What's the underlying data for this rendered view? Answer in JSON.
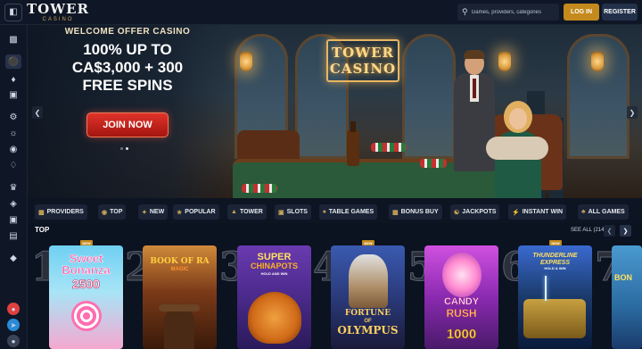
{
  "header": {
    "logo_main": "TOWER",
    "logo_sub": "CASINO",
    "search_placeholder": "Games, providers, categories",
    "login_label": "LOG IN",
    "register_label": "REGISTER"
  },
  "sidebar": {
    "icons": [
      "menu-icon",
      "gift-icon",
      "lobby-icon",
      "casino-icon",
      "live-icon",
      "sports-icon",
      "bonus-icon",
      "promotions-icon",
      "tournament-icon",
      "vip-icon",
      "shop-icon",
      "leaderboard-icon",
      "support-icon",
      "telegram-icon",
      "chat-icon"
    ]
  },
  "hero": {
    "subtitle": "WELCOME OFFER CASINO",
    "title_line1": "100% UP TO",
    "title_line2": "CA$3,000 + 300",
    "title_line3": "FREE SPINS",
    "cta_label": "JOIN NOW",
    "sign_line1": "TOWER",
    "sign_line2": "CASINO",
    "slide_count": 2,
    "active_slide": 1
  },
  "categories": [
    {
      "label": "PROVIDERS",
      "icon": "providers-icon"
    },
    {
      "label": "TOP",
      "icon": "top-icon"
    },
    {
      "label": "NEW",
      "icon": "new-icon"
    },
    {
      "label": "POPULAR",
      "icon": "popular-icon"
    },
    {
      "label": "TOWER",
      "icon": "tower-icon"
    },
    {
      "label": "SLOTS",
      "icon": "slots-icon"
    },
    {
      "label": "TABLE GAMES",
      "icon": "table-games-icon"
    },
    {
      "label": "BONUS BUY",
      "icon": "bonus-buy-icon"
    },
    {
      "label": "JACKPOTS",
      "icon": "jackpots-icon"
    },
    {
      "label": "INSTANT WIN",
      "icon": "instant-win-icon"
    },
    {
      "label": "ALL GAMES",
      "icon": "all-games-icon"
    }
  ],
  "top_section": {
    "title": "TOP",
    "see_all": "SEE ALL (214)",
    "games": [
      {
        "rank": "1",
        "title": "Sweet Bonanza 2500",
        "title_line1": "Sweet",
        "title_line2": "Bonanza",
        "title_line3": "2500",
        "badge": "NEW",
        "bg": "#5ec3ea"
      },
      {
        "rank": "2",
        "title": "Book of Ra Magic",
        "title_line1": "BOOK OF RA",
        "title_line2": "MAGIC",
        "title_line3": "",
        "badge": "",
        "bg": "#5a2a14"
      },
      {
        "rank": "3",
        "title": "Super ChinaPots",
        "title_line1": "SUPER",
        "title_line2": "CHINAPOTS",
        "title_line3": "HOLD AND WIN",
        "badge": "",
        "bg": "#4a2a8a"
      },
      {
        "rank": "4",
        "title": "Fortune of Olympus",
        "title_line1": "FORTUNE",
        "title_line2": "OF",
        "title_line3": "OLYMPUS",
        "badge": "NEW",
        "bg": "#2a3a7a"
      },
      {
        "rank": "5",
        "title": "Candy Rush 1000",
        "title_line1": "CANDY",
        "title_line2": "RUSH",
        "title_line3": "1000",
        "badge": "",
        "bg": "#7a2aa0"
      },
      {
        "rank": "6",
        "title": "Thunderline Express",
        "title_line1": "THUNDERLINE",
        "title_line2": "EXPRESS",
        "title_line3": "HOLD & WIN",
        "badge": "NEW",
        "bg": "#1a3a6a"
      },
      {
        "rank": "7",
        "title": "Bonanza",
        "title_line1": "BON",
        "title_line2": "",
        "title_line3": "",
        "badge": "",
        "bg": "#2a6aa0"
      }
    ]
  }
}
